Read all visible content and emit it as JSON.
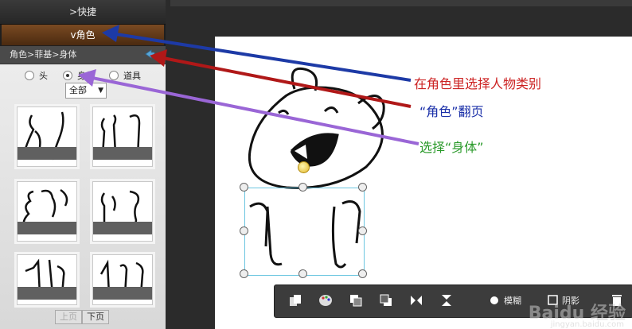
{
  "left_panel": {
    "quick_label": ">快捷",
    "role_label": "v角色",
    "breadcrumb": "角色>菲基>身体",
    "radios": [
      {
        "label": "头",
        "selected": false
      },
      {
        "label": "身体",
        "selected": true
      },
      {
        "label": "道具",
        "selected": false
      }
    ],
    "filter_value": "全部",
    "pager": {
      "prev": "上页",
      "next": "下页"
    }
  },
  "toolbar": {
    "outline_label": "模糊",
    "shadow_label": "阴影"
  },
  "annotations": {
    "note1": "在角色里选择人物类别",
    "note2": "“角色”翻页",
    "note3": "选择“身体”",
    "colors": {
      "note1": "#cc2222",
      "note2": "#1a2fa8",
      "note3": "#2a9a2a",
      "arrow_blue": "#1d3aa6",
      "arrow_red": "#b01818",
      "arrow_purple": "#9a66d6"
    }
  },
  "watermark": {
    "brand": "Baidu 经验",
    "url": "jingyan.baidu.com"
  }
}
